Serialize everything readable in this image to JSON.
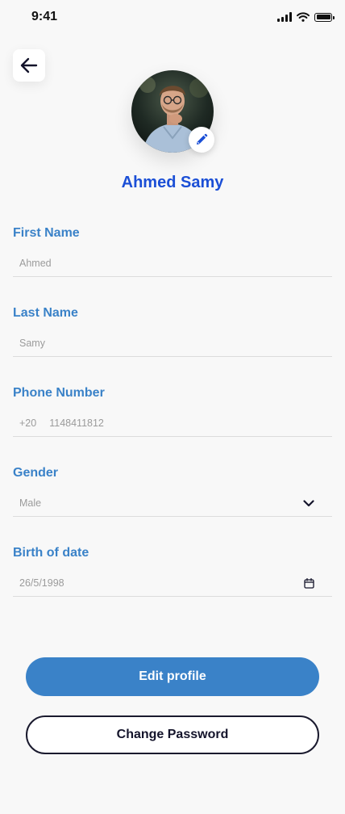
{
  "status_bar": {
    "time": "9:41",
    "icons": [
      "cellular-signal-icon",
      "wifi-icon",
      "battery-icon"
    ]
  },
  "header": {
    "back_icon": "arrow-left-icon"
  },
  "profile": {
    "name": "Ahmed Samy",
    "avatar": "profile-photo",
    "edit_icon": "pencil-icon"
  },
  "fields": {
    "first_name": {
      "label": "First Name",
      "value": "Ahmed"
    },
    "last_name": {
      "label": "Last Name",
      "value": "Samy"
    },
    "phone": {
      "label": "Phone Number",
      "country_code": "+20",
      "value": "1148411812"
    },
    "gender": {
      "label": "Gender",
      "value": "Male",
      "icon": "chevron-down-icon"
    },
    "birth_date": {
      "label": "Birth of date",
      "value": "26/5/1998",
      "icon": "calendar-icon"
    }
  },
  "actions": {
    "edit_profile": "Edit profile",
    "change_password": "Change Password"
  },
  "colors": {
    "background": "#f8f8f8",
    "accent": "#3a82c8",
    "name": "#1b4fd6",
    "outline_button": "#1a1a2e"
  }
}
